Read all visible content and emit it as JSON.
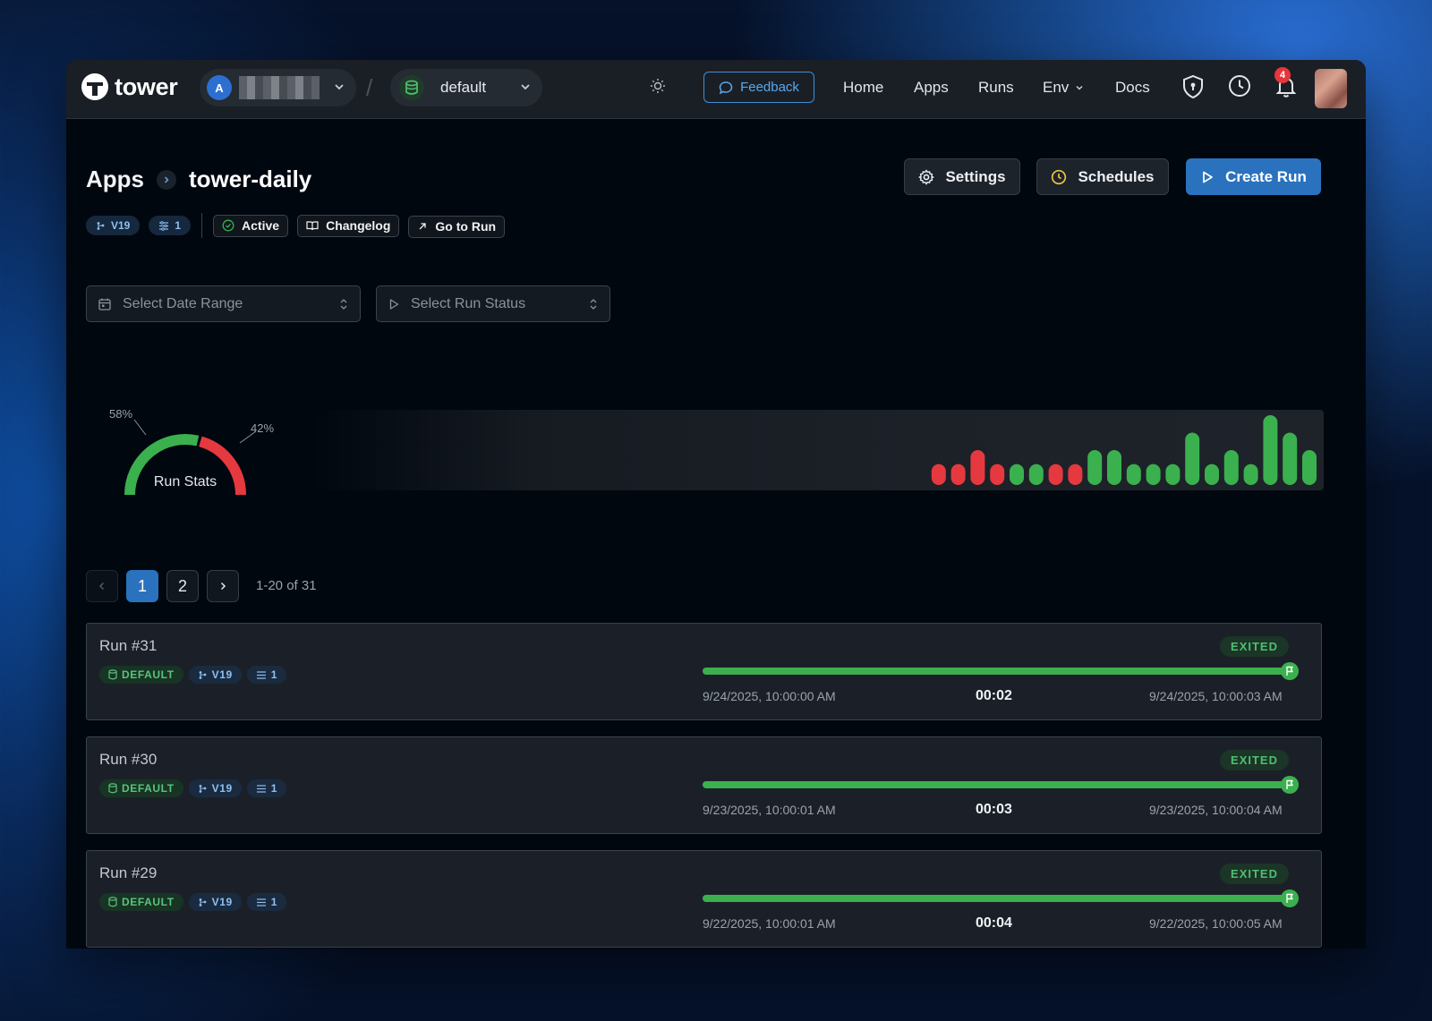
{
  "app": {
    "logo_text": "tower"
  },
  "topbar": {
    "org_initial": "A",
    "environment": "default",
    "feedback_label": "Feedback",
    "nav": [
      "Home",
      "Apps",
      "Runs",
      "Env",
      "Docs"
    ],
    "notification_count": "4"
  },
  "page": {
    "breadcrumb_parent": "Apps",
    "breadcrumb_current": "tower-daily",
    "actions": {
      "settings": "Settings",
      "schedules": "Schedules",
      "create_run": "Create Run"
    },
    "tags": {
      "version": "V19",
      "params": "1",
      "status": "Active",
      "changelog": "Changelog",
      "goto_run": "Go to Run"
    }
  },
  "filters": {
    "date_range_placeholder": "Select Date Range",
    "run_status_placeholder": "Select Run Status"
  },
  "run_stats": {
    "label": "Run Stats",
    "success_percent": "58%",
    "failure_percent": "42%",
    "colors": {
      "success": "#3bb04e",
      "failure": "#e5393f"
    },
    "bars": [
      {
        "status": "failure",
        "value": 3
      },
      {
        "status": "failure",
        "value": 3
      },
      {
        "status": "failure",
        "value": 5
      },
      {
        "status": "failure",
        "value": 3
      },
      {
        "status": "success",
        "value": 3
      },
      {
        "status": "success",
        "value": 3
      },
      {
        "status": "failure",
        "value": 3
      },
      {
        "status": "failure",
        "value": 3
      },
      {
        "status": "success",
        "value": 5
      },
      {
        "status": "success",
        "value": 5
      },
      {
        "status": "success",
        "value": 3
      },
      {
        "status": "success",
        "value": 3
      },
      {
        "status": "success",
        "value": 3
      },
      {
        "status": "success",
        "value": 7.5
      },
      {
        "status": "success",
        "value": 3
      },
      {
        "status": "success",
        "value": 5
      },
      {
        "status": "success",
        "value": 3
      },
      {
        "status": "success",
        "value": 10
      },
      {
        "status": "success",
        "value": 7.5
      },
      {
        "status": "success",
        "value": 5
      }
    ]
  },
  "pagination": {
    "pages": [
      "1",
      "2"
    ],
    "current": "1",
    "range_text": "1-20 of 31"
  },
  "runs": [
    {
      "title": "Run #31",
      "env": "DEFAULT",
      "version": "V19",
      "params": "1",
      "status": "EXITED",
      "progress": 1.0,
      "start": "9/24/2025, 10:00:00 AM",
      "duration": "00:02",
      "end": "9/24/2025, 10:00:03 AM"
    },
    {
      "title": "Run #30",
      "env": "DEFAULT",
      "version": "V19",
      "params": "1",
      "status": "EXITED",
      "progress": 1.0,
      "start": "9/23/2025, 10:00:01 AM",
      "duration": "00:03",
      "end": "9/23/2025, 10:00:04 AM"
    },
    {
      "title": "Run #29",
      "env": "DEFAULT",
      "version": "V19",
      "params": "1",
      "status": "EXITED",
      "progress": 1.0,
      "start": "9/22/2025, 10:00:01 AM",
      "duration": "00:04",
      "end": "9/22/2025, 10:00:05 AM"
    }
  ]
}
